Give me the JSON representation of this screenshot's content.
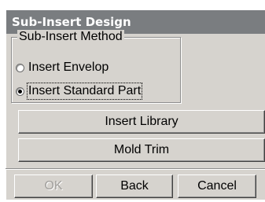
{
  "dialog": {
    "title": "Sub-Insert Design"
  },
  "method_group": {
    "legend": "Sub-Insert Method",
    "options": [
      {
        "label": "Insert Envelop",
        "selected": false
      },
      {
        "label": "Insert Standard Part",
        "selected": true
      }
    ]
  },
  "buttons": {
    "insert_library": "Insert Library",
    "mold_trim": "Mold Trim",
    "ok": "OK",
    "back": "Back",
    "cancel": "Cancel"
  }
}
